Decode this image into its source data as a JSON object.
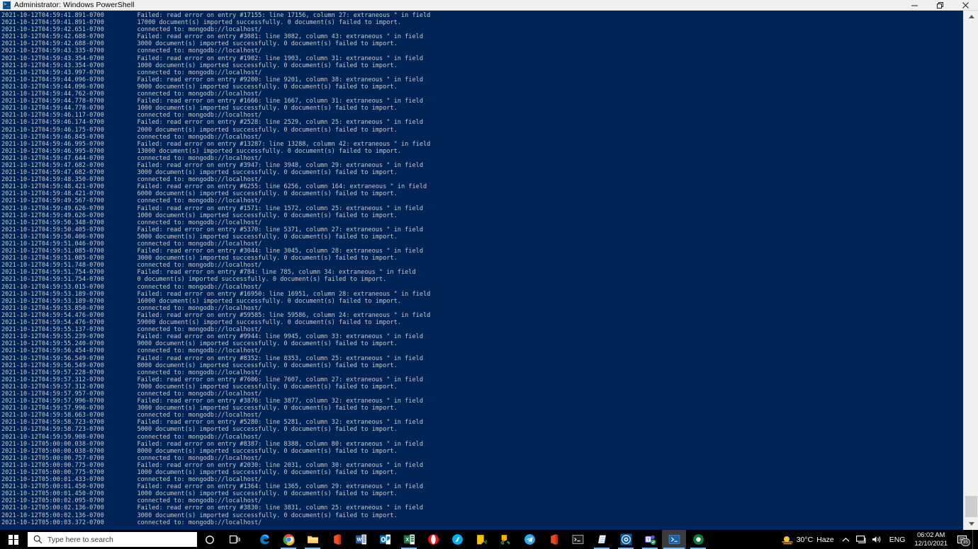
{
  "window": {
    "title": "Administrator: Windows PowerShell",
    "icon": "powershell-icon",
    "minimize_label": "─",
    "maximize_label": "❐",
    "close_label": "✕",
    "background_color": "#012456",
    "text_color": "#cccccc"
  },
  "console": {
    "font": "monospace",
    "lines": [
      {
        "ts": "2021-10-12T04:59:41.891-0700",
        "msg": "Failed: read error on entry #17155: line 17156, column 27: extraneous \" in field"
      },
      {
        "ts": "2021-10-12T04:59:41.891-0700",
        "msg": "17000 document(s) imported successfully. 0 document(s) failed to import."
      },
      {
        "ts": "2021-10-12T04:59:42.651-0700",
        "msg": "connected to: mongodb://localhost/"
      },
      {
        "ts": "2021-10-12T04:59:42.688-0700",
        "msg": "Failed: read error on entry #3081: line 3082, column 43: extraneous \" in field"
      },
      {
        "ts": "2021-10-12T04:59:42.688-0700",
        "msg": "3000 document(s) imported successfully. 0 document(s) failed to import."
      },
      {
        "ts": "2021-10-12T04:59:43.335-0700",
        "msg": "connected to: mongodb://localhost/"
      },
      {
        "ts": "2021-10-12T04:59:43.354-0700",
        "msg": "Failed: read error on entry #1902: line 1903, column 31: extraneous \" in field"
      },
      {
        "ts": "2021-10-12T04:59:43.354-0700",
        "msg": "1000 document(s) imported successfully. 0 document(s) failed to import."
      },
      {
        "ts": "2021-10-12T04:59:43.997-0700",
        "msg": "connected to: mongodb://localhost/"
      },
      {
        "ts": "2021-10-12T04:59:44.096-0700",
        "msg": "Failed: read error on entry #9200: line 9201, column 38: extraneous \" in field"
      },
      {
        "ts": "2021-10-12T04:59:44.096-0700",
        "msg": "9000 document(s) imported successfully. 0 document(s) failed to import."
      },
      {
        "ts": "2021-10-12T04:59:44.762-0700",
        "msg": "connected to: mongodb://localhost/"
      },
      {
        "ts": "2021-10-12T04:59:44.778-0700",
        "msg": "Failed: read error on entry #1666: line 1667, column 31: extraneous \" in field"
      },
      {
        "ts": "2021-10-12T04:59:44.778-0700",
        "msg": "1000 document(s) imported successfully. 0 document(s) failed to import."
      },
      {
        "ts": "2021-10-12T04:59:46.117-0700",
        "msg": "connected to: mongodb://localhost/"
      },
      {
        "ts": "2021-10-12T04:59:46.174-0700",
        "msg": "Failed: read error on entry #2528: line 2529, column 25: extraneous \" in field"
      },
      {
        "ts": "2021-10-12T04:59:46.175-0700",
        "msg": "2000 document(s) imported successfully. 0 document(s) failed to import."
      },
      {
        "ts": "2021-10-12T04:59:46.845-0700",
        "msg": "connected to: mongodb://localhost/"
      },
      {
        "ts": "2021-10-12T04:59:46.995-0700",
        "msg": "Failed: read error on entry #13287: line 13288, column 42: extraneous \" in field"
      },
      {
        "ts": "2021-10-12T04:59:46.995-0700",
        "msg": "13000 document(s) imported successfully. 0 document(s) failed to import."
      },
      {
        "ts": "2021-10-12T04:59:47.644-0700",
        "msg": "connected to: mongodb://localhost/"
      },
      {
        "ts": "2021-10-12T04:59:47.682-0700",
        "msg": "Failed: read error on entry #3947: line 3948, column 29: extraneous \" in field"
      },
      {
        "ts": "2021-10-12T04:59:47.682-0700",
        "msg": "3000 document(s) imported successfully. 0 document(s) failed to import."
      },
      {
        "ts": "2021-10-12T04:59:48.350-0700",
        "msg": "connected to: mongodb://localhost/"
      },
      {
        "ts": "2021-10-12T04:59:48.421-0700",
        "msg": "Failed: read error on entry #6255: line 6256, column 164: extraneous \" in field"
      },
      {
        "ts": "2021-10-12T04:59:48.421-0700",
        "msg": "6000 document(s) imported successfully. 0 document(s) failed to import."
      },
      {
        "ts": "2021-10-12T04:59:49.567-0700",
        "msg": "connected to: mongodb://localhost/"
      },
      {
        "ts": "2021-10-12T04:59:49.626-0700",
        "msg": "Failed: read error on entry #1571: line 1572, column 25: extraneous \" in field"
      },
      {
        "ts": "2021-10-12T04:59:49.626-0700",
        "msg": "1000 document(s) imported successfully. 0 document(s) failed to import."
      },
      {
        "ts": "2021-10-12T04:59:50.348-0700",
        "msg": "connected to: mongodb://localhost/"
      },
      {
        "ts": "2021-10-12T04:59:50.405-0700",
        "msg": "Failed: read error on entry #5370: line 5371, column 27: extraneous \" in field"
      },
      {
        "ts": "2021-10-12T04:59:50.406-0700",
        "msg": "5000 document(s) imported successfully. 0 document(s) failed to import."
      },
      {
        "ts": "2021-10-12T04:59:51.046-0700",
        "msg": "connected to: mongodb://localhost/"
      },
      {
        "ts": "2021-10-12T04:59:51.085-0700",
        "msg": "Failed: read error on entry #3044: line 3045, column 28: extraneous \" in field"
      },
      {
        "ts": "2021-10-12T04:59:51.085-0700",
        "msg": "3000 document(s) imported successfully. 0 document(s) failed to import."
      },
      {
        "ts": "2021-10-12T04:59:51.748-0700",
        "msg": "connected to: mongodb://localhost/"
      },
      {
        "ts": "2021-10-12T04:59:51.754-0700",
        "msg": "Failed: read error on entry #784: line 785, column 34: extraneous \" in field"
      },
      {
        "ts": "2021-10-12T04:59:51.754-0700",
        "msg": "0 document(s) imported successfully. 0 document(s) failed to import."
      },
      {
        "ts": "2021-10-12T04:59:53.015-0700",
        "msg": "connected to: mongodb://localhost/"
      },
      {
        "ts": "2021-10-12T04:59:53.189-0700",
        "msg": "Failed: read error on entry #16950: line 16951, column 28: extraneous \" in field"
      },
      {
        "ts": "2021-10-12T04:59:53.189-0700",
        "msg": "16000 document(s) imported successfully. 0 document(s) failed to import."
      },
      {
        "ts": "2021-10-12T04:59:53.850-0700",
        "msg": "connected to: mongodb://localhost/"
      },
      {
        "ts": "2021-10-12T04:59:54.476-0700",
        "msg": "Failed: read error on entry #59585: line 59586, column 24: extraneous \" in field"
      },
      {
        "ts": "2021-10-12T04:59:54.476-0700",
        "msg": "59000 document(s) imported successfully. 0 document(s) failed to import."
      },
      {
        "ts": "2021-10-12T04:59:55.137-0700",
        "msg": "connected to: mongodb://localhost/"
      },
      {
        "ts": "2021-10-12T04:59:55.239-0700",
        "msg": "Failed: read error on entry #9944: line 9945, column 33: extraneous \" in field"
      },
      {
        "ts": "2021-10-12T04:59:55.240-0700",
        "msg": "9000 document(s) imported successfully. 0 document(s) failed to import."
      },
      {
        "ts": "2021-10-12T04:59:56.454-0700",
        "msg": "connected to: mongodb://localhost/"
      },
      {
        "ts": "2021-10-12T04:59:56.549-0700",
        "msg": "Failed: read error on entry #8352: line 8353, column 25: extraneous \" in field"
      },
      {
        "ts": "2021-10-12T04:59:56.549-0700",
        "msg": "8000 document(s) imported successfully. 0 document(s) failed to import."
      },
      {
        "ts": "2021-10-12T04:59:57.228-0700",
        "msg": "connected to: mongodb://localhost/"
      },
      {
        "ts": "2021-10-12T04:59:57.312-0700",
        "msg": "Failed: read error on entry #7606: line 7607, column 27: extraneous \" in field"
      },
      {
        "ts": "2021-10-12T04:59:57.312-0700",
        "msg": "7000 document(s) imported successfully. 0 document(s) failed to import."
      },
      {
        "ts": "2021-10-12T04:59:57.957-0700",
        "msg": "connected to: mongodb://localhost/"
      },
      {
        "ts": "2021-10-12T04:59:57.996-0700",
        "msg": "Failed: read error on entry #3876: line 3877, column 32: extraneous \" in field"
      },
      {
        "ts": "2021-10-12T04:59:57.996-0700",
        "msg": "3000 document(s) imported successfully. 0 document(s) failed to import."
      },
      {
        "ts": "2021-10-12T04:59:58.663-0700",
        "msg": "connected to: mongodb://localhost/"
      },
      {
        "ts": "2021-10-12T04:59:58.723-0700",
        "msg": "Failed: read error on entry #5280: line 5281, column 32: extraneous \" in field"
      },
      {
        "ts": "2021-10-12T04:59:58.723-0700",
        "msg": "5000 document(s) imported successfully. 0 document(s) failed to import."
      },
      {
        "ts": "2021-10-12T04:59:59.908-0700",
        "msg": "connected to: mongodb://localhost/"
      },
      {
        "ts": "2021-10-12T05:00:00.038-0700",
        "msg": "Failed: read error on entry #8387: line 8388, column 80: extraneous \" in field"
      },
      {
        "ts": "2021-10-12T05:00:00.038-0700",
        "msg": "8000 document(s) imported successfully. 0 document(s) failed to import."
      },
      {
        "ts": "2021-10-12T05:00:00.757-0700",
        "msg": "connected to: mongodb://localhost/"
      },
      {
        "ts": "2021-10-12T05:00:00.775-0700",
        "msg": "Failed: read error on entry #2030: line 2031, column 30: extraneous \" in field"
      },
      {
        "ts": "2021-10-12T05:00:00.775-0700",
        "msg": "1000 document(s) imported successfully. 0 document(s) failed to import."
      },
      {
        "ts": "2021-10-12T05:00:01.433-0700",
        "msg": "connected to: mongodb://localhost/"
      },
      {
        "ts": "2021-10-12T05:00:01.450-0700",
        "msg": "Failed: read error on entry #1364: line 1365, column 29: extraneous \" in field"
      },
      {
        "ts": "2021-10-12T05:00:01.450-0700",
        "msg": "1000 document(s) imported successfully. 0 document(s) failed to import."
      },
      {
        "ts": "2021-10-12T05:00:02.095-0700",
        "msg": "connected to: mongodb://localhost/"
      },
      {
        "ts": "2021-10-12T05:00:02.136-0700",
        "msg": "Failed: read error on entry #3830: line 3831, column 25: extraneous \" in field"
      },
      {
        "ts": "2021-10-12T05:00:02.136-0700",
        "msg": "3000 document(s) imported successfully. 0 document(s) failed to import."
      },
      {
        "ts": "2021-10-12T05:00:03.372-0700",
        "msg": "connected to: mongodb://localhost/"
      }
    ]
  },
  "scrollbar": {
    "up_arrow": "▲",
    "down_arrow": "▼"
  },
  "taskbar": {
    "start_label": "Start",
    "search": {
      "placeholder": "Type here to search",
      "icon": "search-icon"
    },
    "cortana_icon": "cortana-circle-icon",
    "taskview_icon": "task-view-icon",
    "apps": [
      {
        "name": "microsoft-edge",
        "icon": "edge-icon",
        "running": false,
        "active": false
      },
      {
        "name": "google-chrome",
        "icon": "chrome-icon",
        "running": true,
        "active": false
      },
      {
        "name": "file-explorer",
        "icon": "folder-icon",
        "running": true,
        "active": false
      },
      {
        "name": "microsoft-office",
        "icon": "office-icon",
        "running": false,
        "active": false
      },
      {
        "name": "microsoft-word",
        "icon": "word-icon",
        "running": false,
        "active": false
      },
      {
        "name": "microsoft-outlook",
        "icon": "outlook-icon",
        "running": false,
        "active": false
      },
      {
        "name": "microsoft-excel",
        "icon": "excel-icon",
        "running": true,
        "active": false
      },
      {
        "name": "opera",
        "icon": "opera-icon",
        "running": false,
        "active": false
      },
      {
        "name": "skype",
        "icon": "skype-icon",
        "running": false,
        "active": false
      },
      {
        "name": "sticky-notes",
        "icon": "sticky-note-icon",
        "running": false,
        "active": false
      },
      {
        "name": "snip-and-sketch",
        "icon": "snip-sketch-icon",
        "running": false,
        "active": false
      },
      {
        "name": "telegram",
        "icon": "telegram-icon",
        "running": false,
        "active": false
      },
      {
        "name": "office-365",
        "icon": "office-red-icon",
        "running": false,
        "active": false
      },
      {
        "name": "command-prompt",
        "icon": "console-icon",
        "running": false,
        "active": false
      },
      {
        "name": "notepad",
        "icon": "notepad-icon",
        "running": true,
        "active": false
      },
      {
        "name": "mongodb-compass",
        "icon": "compass-icon",
        "running": true,
        "active": false
      },
      {
        "name": "microsoft-teams",
        "icon": "teams-icon",
        "running": true,
        "active": false
      },
      {
        "name": "windows-powershell",
        "icon": "powershell-icon",
        "running": true,
        "active": true
      },
      {
        "name": "vivaldi",
        "icon": "vivaldi-icon",
        "running": true,
        "active": false
      }
    ],
    "tray": {
      "weather_temp": "30°C",
      "weather_condition": "Haze",
      "weather_icon": "sun-haze-icon",
      "overflow_icon": "chevron-up-icon",
      "network_icon": "network-icon",
      "volume_icon": "speaker-icon",
      "language": "ENG",
      "clock_time": "06:02 AM",
      "clock_date": "12/10/2021",
      "notification_icon": "action-center-icon",
      "notification_count": "35"
    }
  }
}
